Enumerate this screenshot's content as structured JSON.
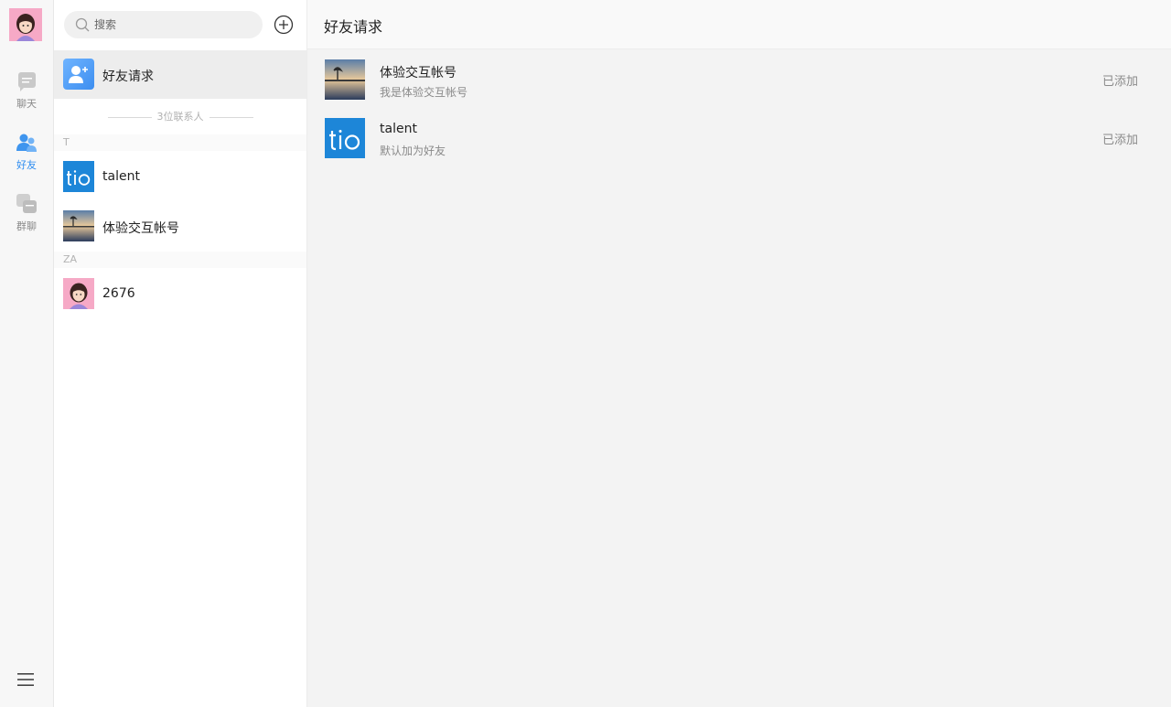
{
  "nav": {
    "items": [
      {
        "label": "聊天",
        "icon": "chat-icon"
      },
      {
        "label": "好友",
        "icon": "friends-icon"
      },
      {
        "label": "群聊",
        "icon": "group-icon"
      }
    ],
    "active": "好友"
  },
  "search": {
    "placeholder": "搜索",
    "value": ""
  },
  "list": {
    "friend_requests_label": "好友请求",
    "contact_count": "3位联系人",
    "groups": [
      {
        "letter": "T",
        "contacts": [
          {
            "name": "talent"
          },
          {
            "name": "体验交互帐号"
          }
        ]
      },
      {
        "letter": "ZA",
        "contacts": [
          {
            "name": "2676"
          }
        ]
      }
    ]
  },
  "main": {
    "title": "好友请求",
    "requests": [
      {
        "name": "体验交互帐号",
        "message": "我是体验交互帐号",
        "status": "已添加"
      },
      {
        "name": "talent",
        "message": "默认加为好友",
        "status": "已添加"
      }
    ]
  },
  "colors": {
    "accent": "#2d8cf0",
    "tio_blue": "#1d86d8"
  }
}
